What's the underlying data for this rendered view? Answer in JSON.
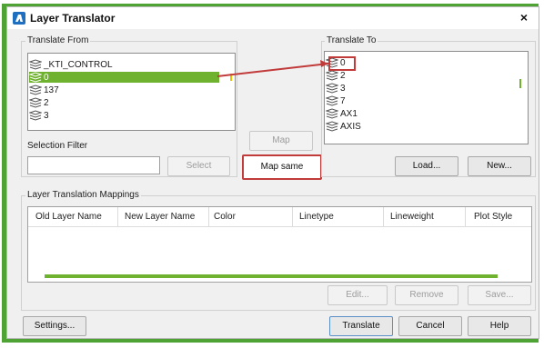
{
  "window": {
    "title": "Layer Translator",
    "close": "×"
  },
  "translate_from": {
    "label": "Translate From",
    "items": [
      {
        "name": "_KTI_CONTROL"
      },
      {
        "name": "0",
        "selected": true
      },
      {
        "name": "137"
      },
      {
        "name": "2"
      },
      {
        "name": "3"
      }
    ]
  },
  "translate_to": {
    "label": "Translate To",
    "items": [
      {
        "name": "0"
      },
      {
        "name": "2"
      },
      {
        "name": "3"
      },
      {
        "name": "7"
      },
      {
        "name": "AX1"
      },
      {
        "name": "AXIS"
      }
    ]
  },
  "selection_filter": {
    "label": "Selection Filter",
    "value": "",
    "select_button": "Select"
  },
  "buttons": {
    "map": "Map",
    "map_same": "Map same",
    "load": "Load...",
    "new": "New...",
    "edit": "Edit...",
    "remove": "Remove",
    "save": "Save...",
    "settings": "Settings...",
    "translate": "Translate",
    "cancel": "Cancel",
    "help": "Help"
  },
  "mappings": {
    "label": "Layer Translation Mappings",
    "columns": [
      "Old Layer Name",
      "New Layer Name",
      "Color",
      "Linetype",
      "Lineweight",
      "Plot Style"
    ]
  },
  "colors": {
    "highlight_red": "#c23b3b",
    "accent_green": "#6fb22f",
    "edge_green": "#4fa234"
  }
}
